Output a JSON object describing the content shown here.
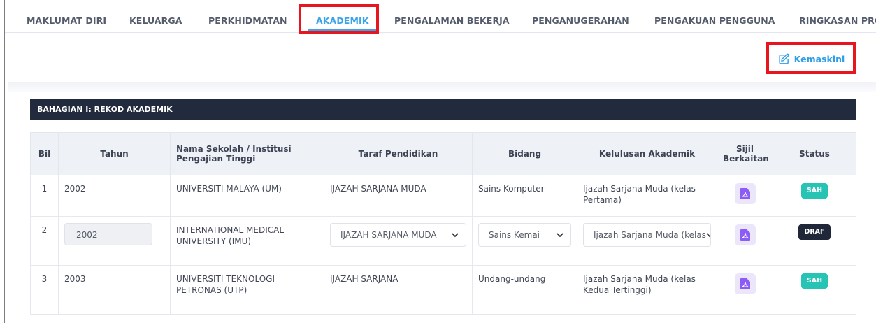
{
  "tabs": [
    {
      "label": "MAKLUMAT DIRI",
      "active": false
    },
    {
      "label": "KELUARGA",
      "active": false
    },
    {
      "label": "PERKHIDMATAN",
      "active": false
    },
    {
      "label": "AKADEMIK",
      "active": true
    },
    {
      "label": "PENGALAMAN BEKERJA",
      "active": false
    },
    {
      "label": "PENGANUGERAHAN",
      "active": false
    },
    {
      "label": "PENGAKUAN PENGGUNA",
      "active": false
    },
    {
      "label": "RINGKASAN PRO",
      "active": false
    }
  ],
  "toolbar": {
    "update_label": "Kemaskini",
    "update_icon": "edit-icon"
  },
  "section": {
    "title": "BAHAGIAN I: REKOD AKADEMIK"
  },
  "table": {
    "headers": {
      "bil": "Bil",
      "tahun": "Tahun",
      "institusi": "Nama Sekolah / Institusi Pengajian Tinggi",
      "taraf": "Taraf Pendidikan",
      "bidang": "Bidang",
      "kelulusan": "Kelulusan Akademik",
      "sijil": "Sijil Berkaitan",
      "status": "Status"
    },
    "rows": [
      {
        "bil": "1",
        "tahun": "2002",
        "institusi": "UNIVERSITI MALAYA (UM)",
        "taraf": "IJAZAH SARJANA MUDA",
        "bidang": "Sains Komputer",
        "kelulusan": "Ijazah Sarjana Muda (kelas Pertama)",
        "status": "SAH"
      },
      {
        "bil": "2",
        "tahun": "2002",
        "institusi": "INTERNATIONAL MEDICAL UNIVERSITY (IMU)",
        "taraf": "IJAZAH SARJANA MUDA",
        "bidang": "Sains Kemai",
        "kelulusan": "Ijazah Sarjana Muda (kelas",
        "status": "DRAF"
      },
      {
        "bil": "3",
        "tahun": "2003",
        "institusi": "UNIVERSITI TEKNOLOGI PETRONAS (UTP)",
        "taraf": "IJAZAH SARJANA",
        "bidang": "Undang-undang",
        "kelulusan": "Ijazah Sarjana Muda (kelas Kedua Tertinggi)",
        "status": "SAH"
      }
    ]
  },
  "colors": {
    "accent": "#3aa4ea",
    "highlight": "#e8141e",
    "header_bar": "#222a3d",
    "sah": "#27c4b5",
    "draf": "#1f2738"
  }
}
